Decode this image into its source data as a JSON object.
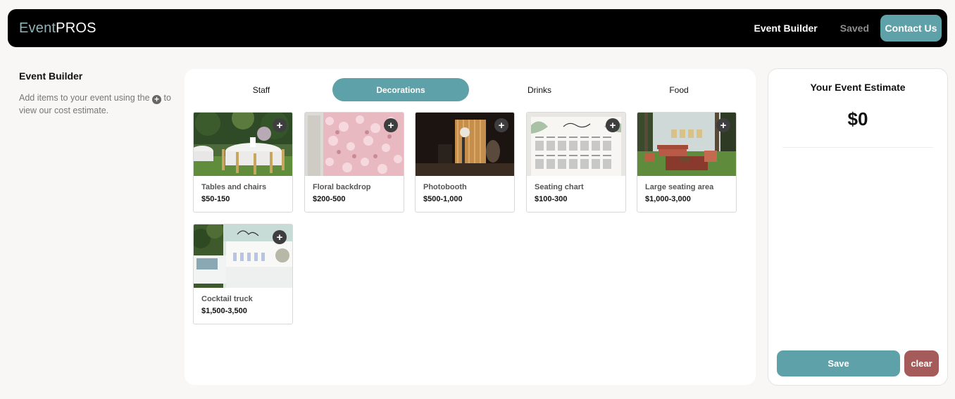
{
  "header": {
    "brand_light": "Event",
    "brand_bold": "PROS",
    "nav": {
      "event_builder": "Event Builder",
      "saved": "Saved",
      "contact": "Contact Us"
    }
  },
  "sidebar": {
    "title": "Event Builder",
    "text_before": "Add items to your event using the",
    "text_after": "to view our cost estimate."
  },
  "tabs": [
    {
      "label": "Staff",
      "active": false
    },
    {
      "label": "Decorations",
      "active": true
    },
    {
      "label": "Drinks",
      "active": false
    },
    {
      "label": "Food",
      "active": false
    }
  ],
  "items": [
    {
      "name": "Tables and chairs",
      "price": "$50-150",
      "icon": "add-icon"
    },
    {
      "name": "Floral backdrop",
      "price": "$200-500",
      "icon": "add-icon"
    },
    {
      "name": "Photobooth",
      "price": "$500-1,000",
      "icon": "add-icon"
    },
    {
      "name": "Seating chart",
      "price": "$100-300",
      "icon": "add-icon"
    },
    {
      "name": "Large seating area",
      "price": "$1,000-3,000",
      "icon": "add-icon"
    },
    {
      "name": "Cocktail truck",
      "price": "$1,500-3,500",
      "icon": "add-icon"
    }
  ],
  "estimate": {
    "title": "Your Event Estimate",
    "amount": "$0",
    "save_label": "Save",
    "clear_label": "clear"
  },
  "colors": {
    "accent": "#5fa1a8",
    "danger": "#a65b5b",
    "header_bg": "#000000"
  }
}
